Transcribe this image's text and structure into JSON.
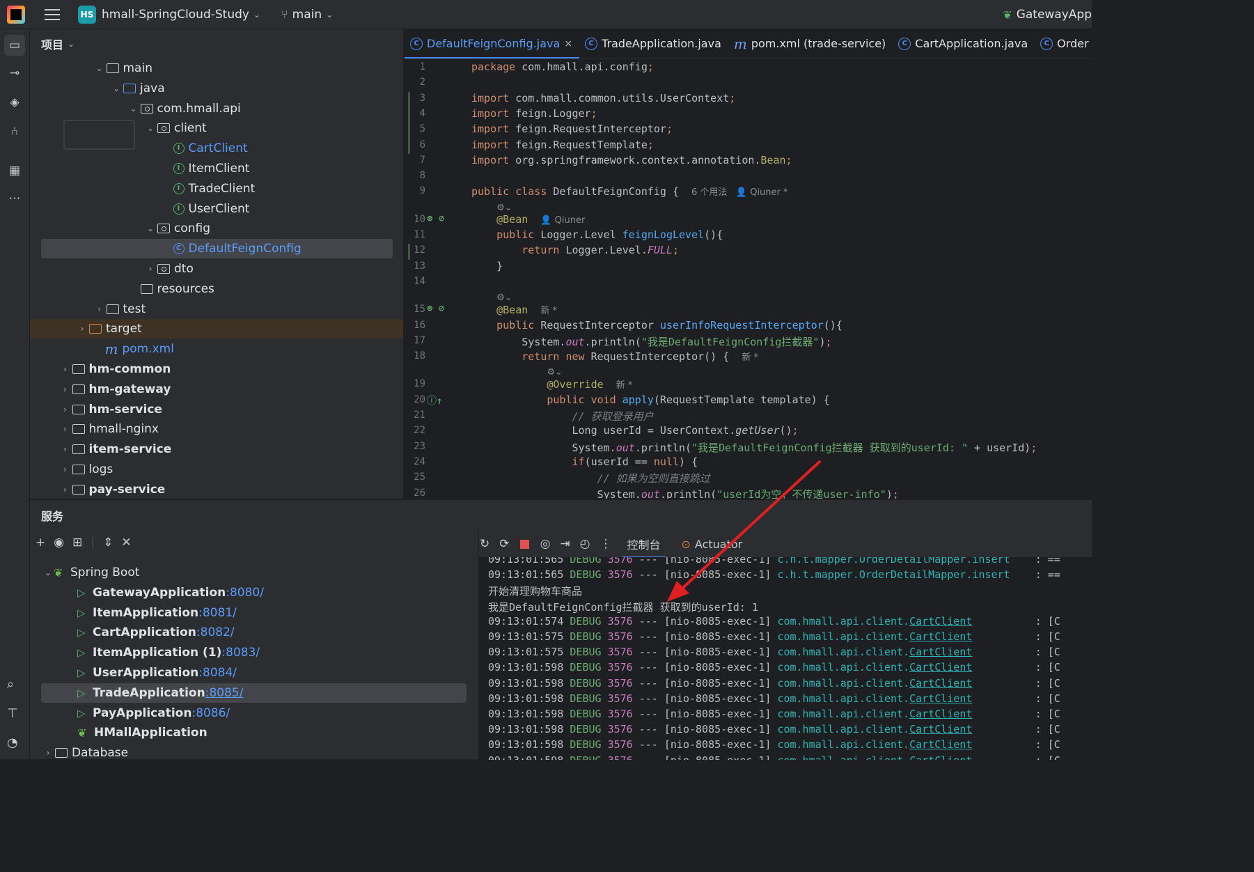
{
  "titlebar": {
    "project_badge": "HS",
    "project_name": "hmall-SpringCloud-Study",
    "branch": "main",
    "run_config": "GatewayApp"
  },
  "project_panel": {
    "title": "项目",
    "tree": [
      {
        "label": "main",
        "type": "folder",
        "depth": 4,
        "arrow": "⌄"
      },
      {
        "label": "java",
        "type": "folder-blue",
        "depth": 5,
        "arrow": "⌄"
      },
      {
        "label": "com.hmall.api",
        "type": "package",
        "depth": 6,
        "arrow": "⌄"
      },
      {
        "label": "client",
        "type": "package",
        "depth": 7,
        "arrow": "⌄"
      },
      {
        "label": "CartClient",
        "type": "interface",
        "depth": 8,
        "arrow": "",
        "color": "blue"
      },
      {
        "label": "ItemClient",
        "type": "interface",
        "depth": 8,
        "arrow": ""
      },
      {
        "label": "TradeClient",
        "type": "interface",
        "depth": 8,
        "arrow": ""
      },
      {
        "label": "UserClient",
        "type": "interface",
        "depth": 8,
        "arrow": ""
      },
      {
        "label": "config",
        "type": "package",
        "depth": 7,
        "arrow": "⌄"
      },
      {
        "label": "DefaultFeignConfig",
        "type": "class",
        "depth": 8,
        "arrow": "",
        "color": "blue",
        "selected": true
      },
      {
        "label": "dto",
        "type": "package",
        "depth": 7,
        "arrow": "›"
      },
      {
        "label": "resources",
        "type": "folder",
        "depth": 6,
        "arrow": ""
      },
      {
        "label": "test",
        "type": "folder",
        "depth": 4,
        "arrow": "›"
      },
      {
        "label": "target",
        "type": "folder-orange",
        "depth": 3,
        "arrow": "›",
        "target": true
      },
      {
        "label": "pom.xml",
        "type": "maven",
        "depth": 4,
        "arrow": "",
        "color": "blue"
      },
      {
        "label": "hm-common",
        "type": "module",
        "depth": 2,
        "arrow": "›",
        "bold": true
      },
      {
        "label": "hm-gateway",
        "type": "module",
        "depth": 2,
        "arrow": "›",
        "bold": true
      },
      {
        "label": "hm-service",
        "type": "module",
        "depth": 2,
        "arrow": "›",
        "bold": true
      },
      {
        "label": "hmall-nginx",
        "type": "folder",
        "depth": 2,
        "arrow": "›"
      },
      {
        "label": "item-service",
        "type": "module",
        "depth": 2,
        "arrow": "›",
        "bold": true
      },
      {
        "label": "logs",
        "type": "folder",
        "depth": 2,
        "arrow": "›"
      },
      {
        "label": "pay-service",
        "type": "module",
        "depth": 2,
        "arrow": "›",
        "bold": true
      }
    ]
  },
  "editor": {
    "tabs": [
      {
        "label": "DefaultFeignConfig.java",
        "icon": "class",
        "active": true,
        "close": "×"
      },
      {
        "label": "TradeApplication.java",
        "icon": "class-run"
      },
      {
        "label": "pom.xml (trade-service)",
        "icon": "maven"
      },
      {
        "label": "CartApplication.java",
        "icon": "class-run"
      },
      {
        "label": "Order",
        "icon": "class"
      }
    ],
    "lines": [
      {
        "n": "1",
        "html": "<span class=\"kw\">package</span> com.hmall.api.config<span class=\"kw\">;</span>"
      },
      {
        "n": "2",
        "html": ""
      },
      {
        "n": "3",
        "html": "<span class=\"kw\">import</span> com.hmall.common.utils.UserContext<span class=\"kw\">;</span>"
      },
      {
        "n": "4",
        "html": "<span class=\"kw\">import</span> feign.Logger<span class=\"kw\">;</span>"
      },
      {
        "n": "5",
        "html": "<span class=\"kw\">import</span> feign.RequestInterceptor<span class=\"kw\">;</span>"
      },
      {
        "n": "6",
        "html": "<span class=\"kw\">import</span> feign.RequestTemplate<span class=\"kw\">;</span>"
      },
      {
        "n": "7",
        "html": "<span class=\"kw\">import</span> org.springframework.context.annotation.<span class=\"ann\">Bean</span><span class=\"kw\">;</span>"
      },
      {
        "n": "8",
        "html": ""
      },
      {
        "n": "9",
        "html": "<span class=\"kw\">public class</span> DefaultFeignConfig {  <span class=\"hint\">6 个用法   👤 Qiuner *</span>"
      },
      {
        "n": "",
        "html": "    <span class=\"inlay\">⚙⌄</span>"
      },
      {
        "n": "10",
        "html": "    <span class=\"ann\">@Bean</span>  <span class=\"hint\">👤 Qiuner</span>"
      },
      {
        "n": "11",
        "html": "    <span class=\"kw\">public</span> Logger.Level <span class=\"fn\">feignLogLevel</span>(){"
      },
      {
        "n": "12",
        "html": "        <span class=\"kw\">return</span> Logger.Level.<span class=\"fld\">FULL</span><span class=\"kw\">;</span>"
      },
      {
        "n": "13",
        "html": "    }"
      },
      {
        "n": "14",
        "html": ""
      },
      {
        "n": "",
        "html": "    <span class=\"inlay\">⚙⌄</span>"
      },
      {
        "n": "15",
        "html": "    <span class=\"ann\">@Bean</span>  <span class=\"hint\">新 *</span>"
      },
      {
        "n": "16",
        "html": "    <span class=\"kw\">public</span> RequestInterceptor <span class=\"fn\">userInfoRequestInterceptor</span>(){"
      },
      {
        "n": "17",
        "html": "        System.<span class=\"fld\">out</span>.println(<span class=\"str\">\"我是DefaultFeignConfig拦截器\"</span>)<span class=\"kw\">;</span>"
      },
      {
        "n": "18",
        "html": "        <span class=\"kw\">return new</span> RequestInterceptor() {  <span class=\"hint\">新 *</span>"
      },
      {
        "n": "",
        "html": "            <span class=\"inlay\">⚙⌄</span>"
      },
      {
        "n": "19",
        "html": "            <span class=\"ann\">@Override</span>  <span class=\"hint\">新 *</span>"
      },
      {
        "n": "20",
        "html": "            <span class=\"kw\">public void</span> <span class=\"fn\">apply</span>(RequestTemplate template) {"
      },
      {
        "n": "21",
        "html": "                <span class=\"cmt\">// 获取登录用户</span>"
      },
      {
        "n": "22",
        "html": "                Long userId = UserContext.<span class=\"stat\">getUser</span>()<span class=\"kw\">;</span>"
      },
      {
        "n": "23",
        "html": "                System.<span class=\"fld\">out</span>.println(<span class=\"str\">\"我是DefaultFeignConfig拦截器 获取到的userId: \"</span> + userId)<span class=\"kw\">;</span>"
      },
      {
        "n": "24",
        "html": "                <span class=\"kw\">if</span>(userId == <span class=\"kw\">null</span>) {"
      },
      {
        "n": "25",
        "html": "                    <span class=\"cmt\">// 如果为空则直接跳过</span>"
      },
      {
        "n": "26",
        "html": "                    System.<span class=\"fld\">out</span>.println(<span class=\"str\">\"userId为空，不传递user-info\"</span>)<span class=\"kw\">;</span>"
      }
    ]
  },
  "services": {
    "title": "服务",
    "tree": [
      {
        "label": "Spring Boot",
        "type": "group",
        "depth": 1,
        "arrow": "⌄"
      },
      {
        "label": "GatewayApplication",
        "port": ":8080/",
        "depth": 2
      },
      {
        "label": "ItemApplication",
        "port": ":8081/",
        "depth": 2
      },
      {
        "label": "CartApplication",
        "port": ":8082/",
        "depth": 2
      },
      {
        "label": "ItemApplication (1)",
        "port": ":8083/",
        "depth": 2
      },
      {
        "label": "UserApplication",
        "port": ":8084/",
        "depth": 2
      },
      {
        "label": "TradeApplication",
        "port": ":8085/",
        "depth": 2,
        "selected": true
      },
      {
        "label": "PayApplication",
        "port": ":8086/",
        "depth": 2
      },
      {
        "label": "HMallApplication",
        "port": "",
        "depth": 2,
        "spring": true
      },
      {
        "label": "Database",
        "type": "folder",
        "depth": 1,
        "arrow": "›"
      }
    ],
    "console_tabs": [
      "控制台",
      "Actuator"
    ],
    "console_lines": [
      {
        "kind": "log",
        "time": "09:13:01:565",
        "level": "DEBUG",
        "pid": "3576",
        "thread": "--- [nio-8085-exec-1]",
        "logger_prefix": "c.h.t.mapper.",
        "logger_name": "OrderDetailMapper.insert",
        "tail": "    : ==",
        "ul": false
      },
      {
        "kind": "log",
        "time": "09:13:01:565",
        "level": "DEBUG",
        "pid": "3576",
        "thread": "--- [nio-8085-exec-1]",
        "logger_prefix": "c.h.t.mapper.",
        "logger_name": "OrderDetailMapper.insert",
        "tail": "    : ==",
        "ul": false
      },
      {
        "kind": "text",
        "text": "开始清理购物车商品"
      },
      {
        "kind": "text",
        "text": "我是DefaultFeignConfig拦截器 获取到的userId: 1"
      },
      {
        "kind": "log",
        "time": "09:13:01:574",
        "level": "DEBUG",
        "pid": "3576",
        "thread": "--- [nio-8085-exec-1]",
        "logger_prefix": "com.hmall.api.client.",
        "logger_name": "CartClient",
        "tail": "          : [C",
        "ul": true
      },
      {
        "kind": "log",
        "time": "09:13:01:575",
        "level": "DEBUG",
        "pid": "3576",
        "thread": "--- [nio-8085-exec-1]",
        "logger_prefix": "com.hmall.api.client.",
        "logger_name": "CartClient",
        "tail": "          : [C",
        "ul": true
      },
      {
        "kind": "log",
        "time": "09:13:01:575",
        "level": "DEBUG",
        "pid": "3576",
        "thread": "--- [nio-8085-exec-1]",
        "logger_prefix": "com.hmall.api.client.",
        "logger_name": "CartClient",
        "tail": "          : [C",
        "ul": true
      },
      {
        "kind": "log",
        "time": "09:13:01:598",
        "level": "DEBUG",
        "pid": "3576",
        "thread": "--- [nio-8085-exec-1]",
        "logger_prefix": "com.hmall.api.client.",
        "logger_name": "CartClient",
        "tail": "          : [C",
        "ul": true
      },
      {
        "kind": "log",
        "time": "09:13:01:598",
        "level": "DEBUG",
        "pid": "3576",
        "thread": "--- [nio-8085-exec-1]",
        "logger_prefix": "com.hmall.api.client.",
        "logger_name": "CartClient",
        "tail": "          : [C",
        "ul": true
      },
      {
        "kind": "log",
        "time": "09:13:01:598",
        "level": "DEBUG",
        "pid": "3576",
        "thread": "--- [nio-8085-exec-1]",
        "logger_prefix": "com.hmall.api.client.",
        "logger_name": "CartClient",
        "tail": "          : [C",
        "ul": true
      },
      {
        "kind": "log",
        "time": "09:13:01:598",
        "level": "DEBUG",
        "pid": "3576",
        "thread": "--- [nio-8085-exec-1]",
        "logger_prefix": "com.hmall.api.client.",
        "logger_name": "CartClient",
        "tail": "          : [C",
        "ul": true
      },
      {
        "kind": "log",
        "time": "09:13:01:598",
        "level": "DEBUG",
        "pid": "3576",
        "thread": "--- [nio-8085-exec-1]",
        "logger_prefix": "com.hmall.api.client.",
        "logger_name": "CartClient",
        "tail": "          : [C",
        "ul": true
      },
      {
        "kind": "log",
        "time": "09:13:01:598",
        "level": "DEBUG",
        "pid": "3576",
        "thread": "--- [nio-8085-exec-1]",
        "logger_prefix": "com.hmall.api.client.",
        "logger_name": "CartClient",
        "tail": "          : [C",
        "ul": true
      },
      {
        "kind": "log",
        "time": "09:13:01:598",
        "level": "DEBUG",
        "pid": "3576",
        "thread": "--- [nio-8085-exec-1]",
        "logger_prefix": "com.hmall.api.client.",
        "logger_name": "CartClient",
        "tail": "          : [C",
        "ul": true
      }
    ]
  },
  "colors": {
    "accent": "#4a8cf7",
    "annotation_arrow": "#e02020",
    "background": "#1e1f22",
    "panel": "#2b2d30"
  }
}
